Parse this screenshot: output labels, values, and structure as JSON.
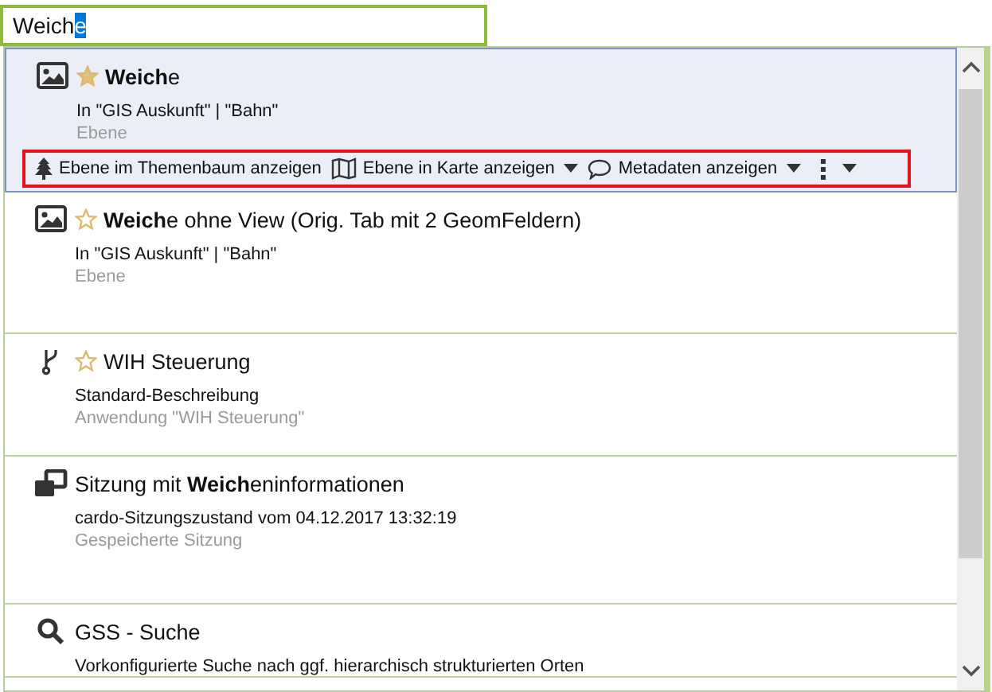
{
  "search": {
    "value": "Weich",
    "selection": "e"
  },
  "results": [
    {
      "kind": "layer",
      "title": "**Weich**e",
      "favorite": true,
      "selected": true,
      "context": "In \"GIS Auskunft\" | \"Bahn\"",
      "type": "Ebene",
      "actions": [
        {
          "kind": "tree",
          "label": "Ebene im Themenbaum anzeigen",
          "dropdown": false
        },
        {
          "kind": "map",
          "label": "Ebene in Karte anzeigen",
          "dropdown": true
        },
        {
          "kind": "comment",
          "label": "Metadaten anzeigen",
          "dropdown": true
        },
        {
          "kind": "more",
          "dropdown": true
        }
      ]
    },
    {
      "kind": "layer",
      "title": "**Weich**e ohne View (Orig. Tab mit 2 GeomFeldern)",
      "favorite": false,
      "selected": false,
      "context": "In \"GIS Auskunft\" | \"Bahn\"",
      "type": "Ebene"
    },
    {
      "kind": "application",
      "title": "WIH Steuerung",
      "favorite": false,
      "selected": false,
      "context": "Standard-Beschreibung",
      "type": "Anwendung \"WIH Steuerung\""
    },
    {
      "kind": "session",
      "title": "Sitzung mit **Weich**eninformationen",
      "selected": false,
      "context": "cardo-Sitzungszustand vom 04.12.2017 13:32:19",
      "type": "Gespeicherte Sitzung"
    },
    {
      "kind": "search",
      "title": "GSS - Suche",
      "selected": false,
      "context": "Vorkonfigurierte Suche nach ggf. hierarchisch strukturierten Orten"
    }
  ]
}
